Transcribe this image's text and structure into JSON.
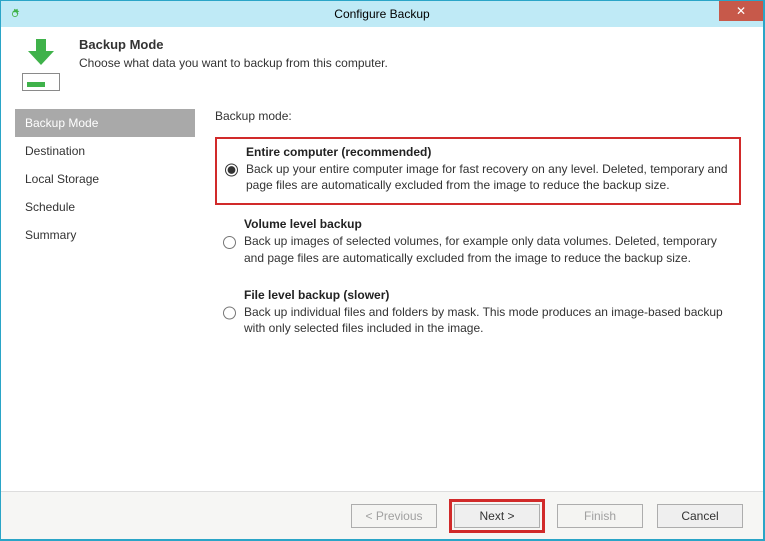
{
  "window": {
    "title": "Configure Backup",
    "close_glyph": "✕"
  },
  "header": {
    "title": "Backup Mode",
    "subtitle": "Choose what data you want to backup from this computer."
  },
  "sidebar": {
    "items": [
      {
        "label": "Backup Mode",
        "active": true
      },
      {
        "label": "Destination",
        "active": false
      },
      {
        "label": "Local Storage",
        "active": false
      },
      {
        "label": "Schedule",
        "active": false
      },
      {
        "label": "Summary",
        "active": false
      }
    ]
  },
  "content": {
    "title": "Backup mode:",
    "options": [
      {
        "id": "entire",
        "label": "Entire computer (recommended)",
        "desc": "Back up your entire computer image for fast recovery on any level. Deleted, temporary and page files are automatically excluded from the image to reduce the backup size.",
        "selected": true,
        "highlight": true
      },
      {
        "id": "volume",
        "label": "Volume level backup",
        "desc": "Back up images of selected volumes, for example only data volumes. Deleted, temporary and page files are automatically excluded from the image to reduce the backup size.",
        "selected": false,
        "highlight": false
      },
      {
        "id": "file",
        "label": "File level backup (slower)",
        "desc": "Back up individual files and folders by mask. This mode produces an image-based backup with only selected files included in the image.",
        "selected": false,
        "highlight": false
      }
    ]
  },
  "footer": {
    "previous": "< Previous",
    "next": "Next >",
    "finish": "Finish",
    "cancel": "Cancel",
    "previous_enabled": false,
    "next_enabled": true,
    "finish_enabled": false,
    "cancel_enabled": true,
    "next_highlight": true
  },
  "colors": {
    "accent": "#3fb24a",
    "titlebar": "#bfeaf6",
    "border": "#2aa5c7",
    "highlight": "#d12a2a",
    "close": "#c7594a"
  }
}
